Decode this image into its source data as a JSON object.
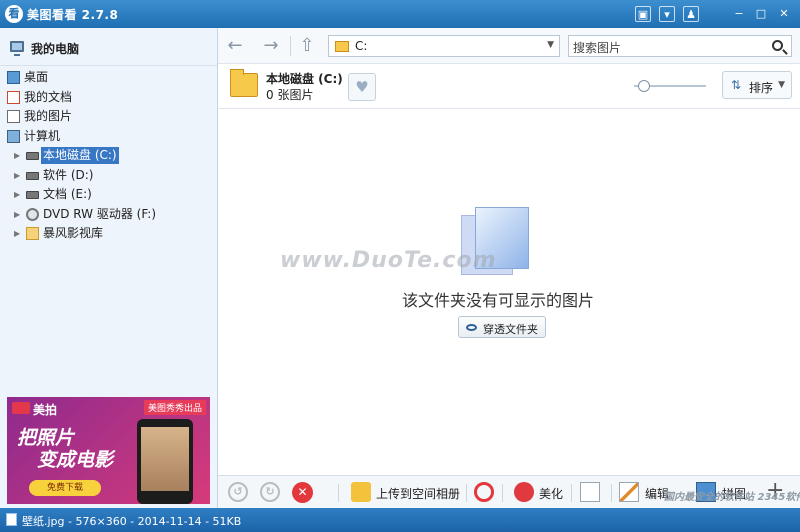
{
  "window": {
    "title": "美图看看 2.7.8",
    "app_icon": "看"
  },
  "titlebar_buttons": [
    {
      "name": "miniplayer-icon",
      "glyph": "▣"
    },
    {
      "name": "menu-icon",
      "glyph": "▾"
    },
    {
      "name": "skin-icon",
      "glyph": "♟"
    },
    {
      "name": "minimize-icon",
      "glyph": "−"
    },
    {
      "name": "maximize-icon",
      "glyph": "□"
    },
    {
      "name": "close-icon",
      "glyph": "✕"
    }
  ],
  "sidebar": {
    "header": "我的电脑",
    "tree": [
      {
        "label": "桌面",
        "icon": "desktop-icon",
        "level": 0,
        "expandable": false,
        "selected": false
      },
      {
        "label": "我的文档",
        "icon": "documents-icon",
        "level": 0,
        "expandable": false,
        "selected": false
      },
      {
        "label": "我的图片",
        "icon": "pictures-icon",
        "level": 0,
        "expandable": false,
        "selected": false
      },
      {
        "label": "计算机",
        "icon": "computer-icon",
        "level": 0,
        "expandable": false,
        "selected": false
      },
      {
        "label": "本地磁盘 (C:)",
        "icon": "drive-icon",
        "level": 1,
        "expandable": true,
        "selected": true
      },
      {
        "label": "软件 (D:)",
        "icon": "drive-icon",
        "level": 1,
        "expandable": true,
        "selected": false
      },
      {
        "label": "文档 (E:)",
        "icon": "drive-icon",
        "level": 1,
        "expandable": true,
        "selected": false
      },
      {
        "label": "DVD RW 驱动器 (F:)",
        "icon": "dvd-icon",
        "level": 1,
        "expandable": true,
        "selected": false
      },
      {
        "label": "暴风影视库",
        "icon": "folder-icon",
        "level": 1,
        "expandable": true,
        "selected": false
      }
    ]
  },
  "ad": {
    "logo": "美拍",
    "tag": "美图秀秀出品",
    "line1": "把照片",
    "line2": "变成电影",
    "button": "免费下载"
  },
  "toolbar": {
    "address": "C:",
    "search_placeholder": "搜索图片"
  },
  "folder_info": {
    "title": "本地磁盘 (C:)",
    "count": "0 张图片",
    "sort_label": "排序",
    "zoom_level": 0.05
  },
  "content": {
    "empty_message": "该文件夹没有可显示的图片",
    "through_button": "穿透文件夹",
    "watermark": "www.DuoTe.com"
  },
  "bottombar": {
    "upload": "上传到空间相册",
    "beautify": "美化",
    "edit": "编辑",
    "puzzle": "拼图"
  },
  "status": {
    "text": "壁纸.jpg - 576×360 - 2014-11-14 - 51KB"
  },
  "corner_watermark": "国内最安全的软件站 2345软件大全",
  "colors": {
    "accent": "#1f6fb3",
    "selection": "#3877c4",
    "delete": "#e2383b"
  }
}
